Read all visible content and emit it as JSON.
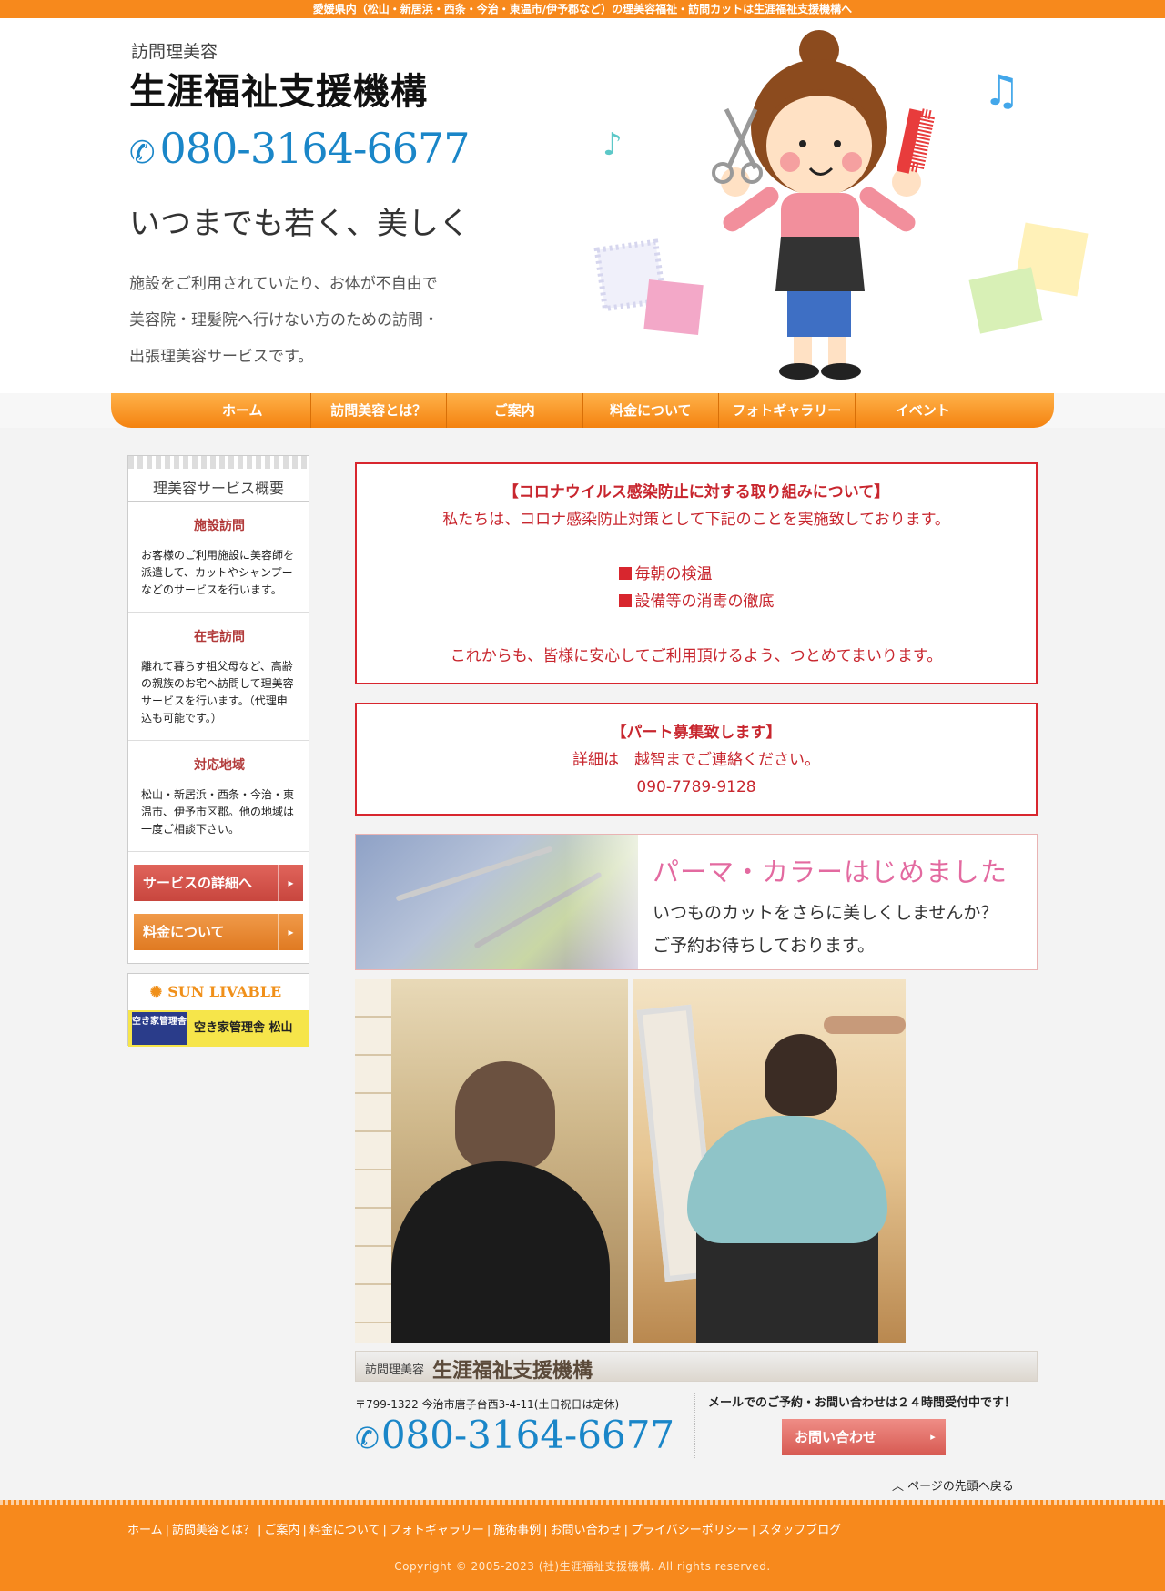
{
  "topbar": {
    "text": "愛媛県内（松山・新居浜・西条・今治・東温市/伊予郡など）の理美容福祉・訪問カットは生涯福祉支援機構へ"
  },
  "header": {
    "subtitle": "訪問理美容",
    "title": "生涯福祉支援機構",
    "phone": "080-3164-6677",
    "catch": "いつまでも若く、美しく",
    "description": "施設をご利用されていたり、お体が不自由で美容院・理髪院へ行けない方のための訪問・出張理美容サービスです。"
  },
  "nav": {
    "items": [
      {
        "label": "ホーム"
      },
      {
        "label": "訪問美容とは？"
      },
      {
        "label": "ご案内"
      },
      {
        "label": "料金について"
      },
      {
        "label": "フォトギャラリー"
      },
      {
        "label": "イベント"
      }
    ]
  },
  "sidebar": {
    "title": "理美容サービス概要",
    "sections": [
      {
        "heading": "施設訪問",
        "text": "お客様のご利用施設に美容師を派遣して、カットやシャンプーなどのサービスを行います。"
      },
      {
        "heading": "在宅訪問",
        "text": "離れて暮らす祖父母など、高齢の親族のお宅へ訪問して理美容サービスを行います。（代理申込も可能です。）"
      },
      {
        "heading": "対応地域",
        "text": "松山・新居浜・西条・今治・東温市、伊予市区郡。他の地域は一度ご相談下さい。"
      }
    ],
    "buttons": [
      {
        "label": "サービスの詳細へ"
      },
      {
        "label": "料金について"
      }
    ],
    "banner": {
      "brand": "SUN LIVABLE",
      "text": "空き家管理舎 松山",
      "logo_text": "空き家管理舎"
    }
  },
  "notice1": {
    "title": "【コロナウイルス感染防止に対する取り組みについて】",
    "line1": "私たちは、コロナ感染防止対策として下記のことを実施致しております。",
    "items": [
      "毎朝の検温",
      "設備等の消毒の徹底"
    ],
    "closing": "これからも、皆様に安心してご利用頂けるよう、つとめてまいります。"
  },
  "notice2": {
    "title": "【パート募集致します】",
    "line1": "詳細は　越智までご連絡ください。",
    "phone": "090-7789-9128"
  },
  "perm": {
    "title": "パーマ・カラーはじめました",
    "line1": "いつものカットをさらに美しくしませんか？",
    "line2": "ご予約お待ちしております。"
  },
  "footer_info": {
    "subtitle": "訪問理美容",
    "title": "生涯福祉支援機構",
    "address": "〒799-1322 今治市唐子台西3-4-11(土日祝日は定休)",
    "phone": "080-3164-6677",
    "mail_text": "メールでのご予約・お問い合わせは２４時間受付中です！",
    "contact_button": "お問い合わせ"
  },
  "to_top": "ページの先頭へ戻る",
  "footer": {
    "links": [
      "ホーム",
      "訪問美容とは？",
      "ご案内",
      "料金について",
      "フォトギャラリー",
      "施術事例",
      "お問い合わせ",
      "プライバシーポリシー",
      "スタッフブログ"
    ],
    "copyright": "Copyright © 2005-2023 (社)生涯福祉支援機構. All rights reserved."
  },
  "colors": {
    "accent": "#f7891c",
    "notice_red": "#d8262e",
    "phone_blue": "#1a86c8"
  },
  "icons": {
    "phone": "phone-icon",
    "arrow": "chevron-right-icon",
    "to_top": "caret-up-icon"
  }
}
